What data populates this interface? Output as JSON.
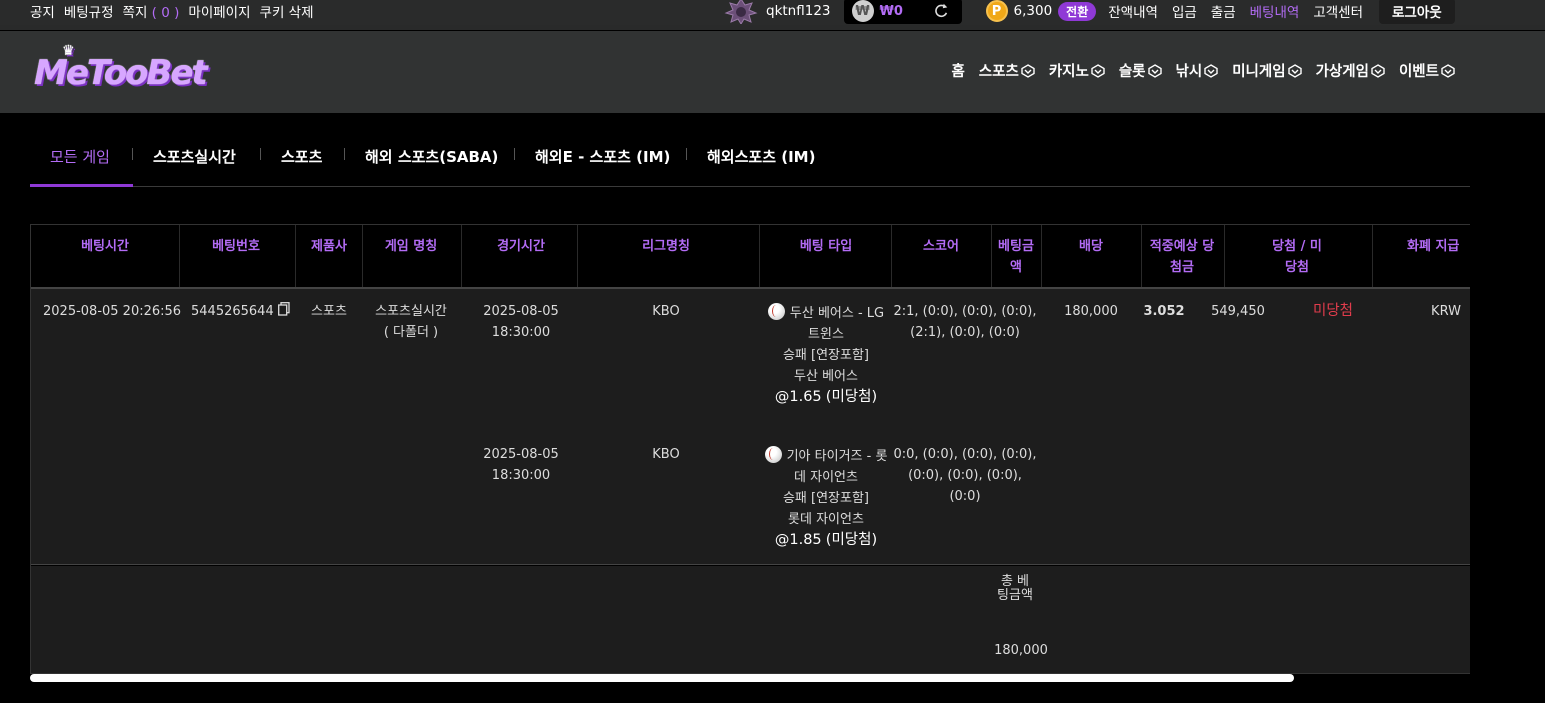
{
  "topbar": {
    "links": [
      "공지",
      "베팅규정",
      "쪽지"
    ],
    "message_count_open": "(",
    "message_count": "0",
    "message_count_close": ")",
    "links2": [
      "마이페이지",
      "쿠키 삭제"
    ],
    "username": "qktnfl123",
    "won_symbol": "₩",
    "balance": "₩0",
    "point_symbol": "P",
    "points": "6,300",
    "convert_label": "전환",
    "right_links": [
      "잔액내역",
      "입금",
      "출금",
      "베팅내역",
      "고객센터"
    ],
    "active_link": "베팅내역",
    "logout_label": "로그아웃"
  },
  "header": {
    "logo_text": "MeTooBet",
    "nav": [
      "홈",
      "스포츠",
      "카지노",
      "슬롯",
      "낚시",
      "미니게임",
      "가상게임",
      "이벤트"
    ]
  },
  "tabs": [
    "모든 게임",
    "스포츠실시간",
    "스포츠",
    "해외 스포츠(SABA)",
    "해외E - 스포츠 (IM)",
    "해외스포츠 (IM)"
  ],
  "table": {
    "headers": [
      "베팅시간",
      "베팅번호",
      "제품사",
      "게임 명칭",
      "경기시간",
      "리그명칭",
      "베팅 타입",
      "스코어",
      "베팅금액",
      "배당",
      "적중예상 당첨금",
      "당첨 / 미당첨",
      "화폐 지급"
    ],
    "bet": {
      "time": "2025-08-05 20:26:56",
      "number": "5445265644",
      "provider": "스포츠",
      "game_name": "스포츠실시간",
      "game_sub": "( 다폴더 )",
      "amount": "180,000",
      "odds": "3.052",
      "expected": "549,450",
      "result": "미당첨",
      "currency": "KRW"
    },
    "legs": [
      {
        "date": "2025-08-05",
        "time": "18:30:00",
        "league": "KBO",
        "teams": "두산 베어스 - LG 트윈스",
        "market": "승패 [연장포함]",
        "pick": "두산 베어스",
        "odds": "@1.65",
        "status": "(미당첨)",
        "score": "2:1, (0:0), (0:0), (0:0), (2:1), (0:0), (0:0)"
      },
      {
        "date": "2025-08-05",
        "time": "18:30:00",
        "league": "KBO",
        "teams": "기아 타이거즈 - 롯데 자이언츠",
        "market": "승패 [연장포함]",
        "pick": "롯데 자이언츠",
        "odds": "@1.85",
        "status": "(미당첨)",
        "score": "0:0, (0:0), (0:0), (0:0), (0:0), (0:0), (0:0), (0:0)"
      }
    ],
    "footer_label": "총 베팅금액",
    "footer_value": "180,000"
  },
  "colors": {
    "accent": "#b36cf5",
    "miss": "#e03c4c",
    "point": "#f0a818"
  }
}
